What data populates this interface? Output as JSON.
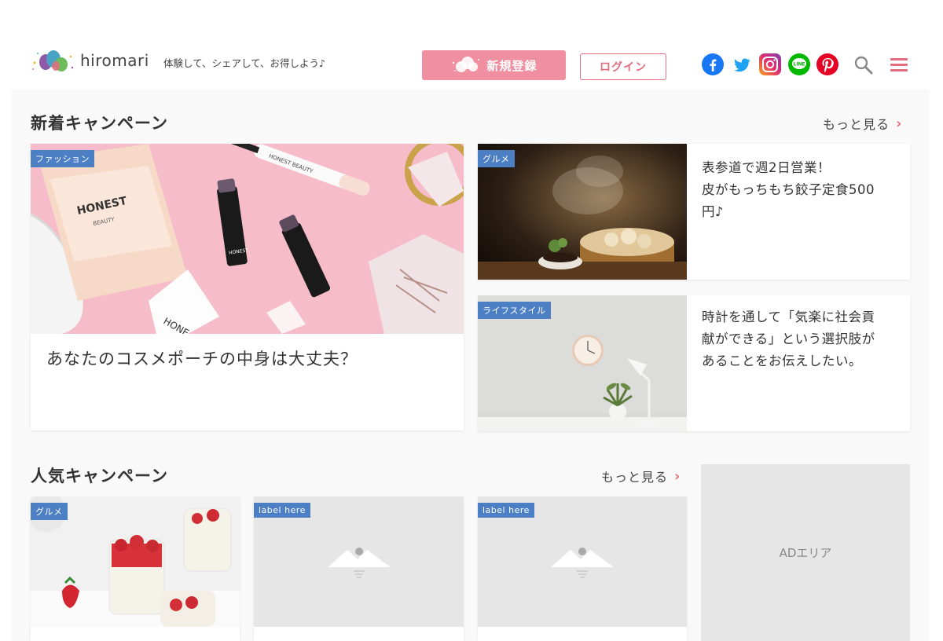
{
  "header": {
    "logo_text": "hiromari",
    "tagline": "体験して、シェアして、お得しよう♪",
    "register_label": "新規登録",
    "login_label": "ログイン",
    "social": [
      "facebook-icon",
      "twitter-icon",
      "instagram-icon",
      "line-icon",
      "pinterest-icon"
    ],
    "accent_color": "#e46c7f",
    "register_color": "#ef8fa0",
    "label_color": "#4d7fc4"
  },
  "new_campaigns": {
    "title": "新着キャンペーン",
    "more": "もっと見る",
    "featured": {
      "category": "ファッション",
      "title": "あなたのコスメポーチの中身は大丈夫？"
    },
    "side": [
      {
        "category": "グルメ",
        "title_line1": "表参道で週2日営業！",
        "title_line2": "皮がもっちもち餃子定食500",
        "title_line3": "円♪"
      },
      {
        "category": "ライフスタイル",
        "title_line1": "時計を通して「気楽に社会貢",
        "title_line2": "献ができる」という選択肢が",
        "title_line3": "あることをお伝えしたい。"
      }
    ]
  },
  "popular_campaigns": {
    "title": "人気キャンペーン",
    "more": "もっと見る",
    "cards": [
      {
        "category": "グルメ"
      },
      {
        "category": "label here"
      },
      {
        "category": "label here"
      }
    ]
  },
  "ad": {
    "label": "ADエリア"
  }
}
